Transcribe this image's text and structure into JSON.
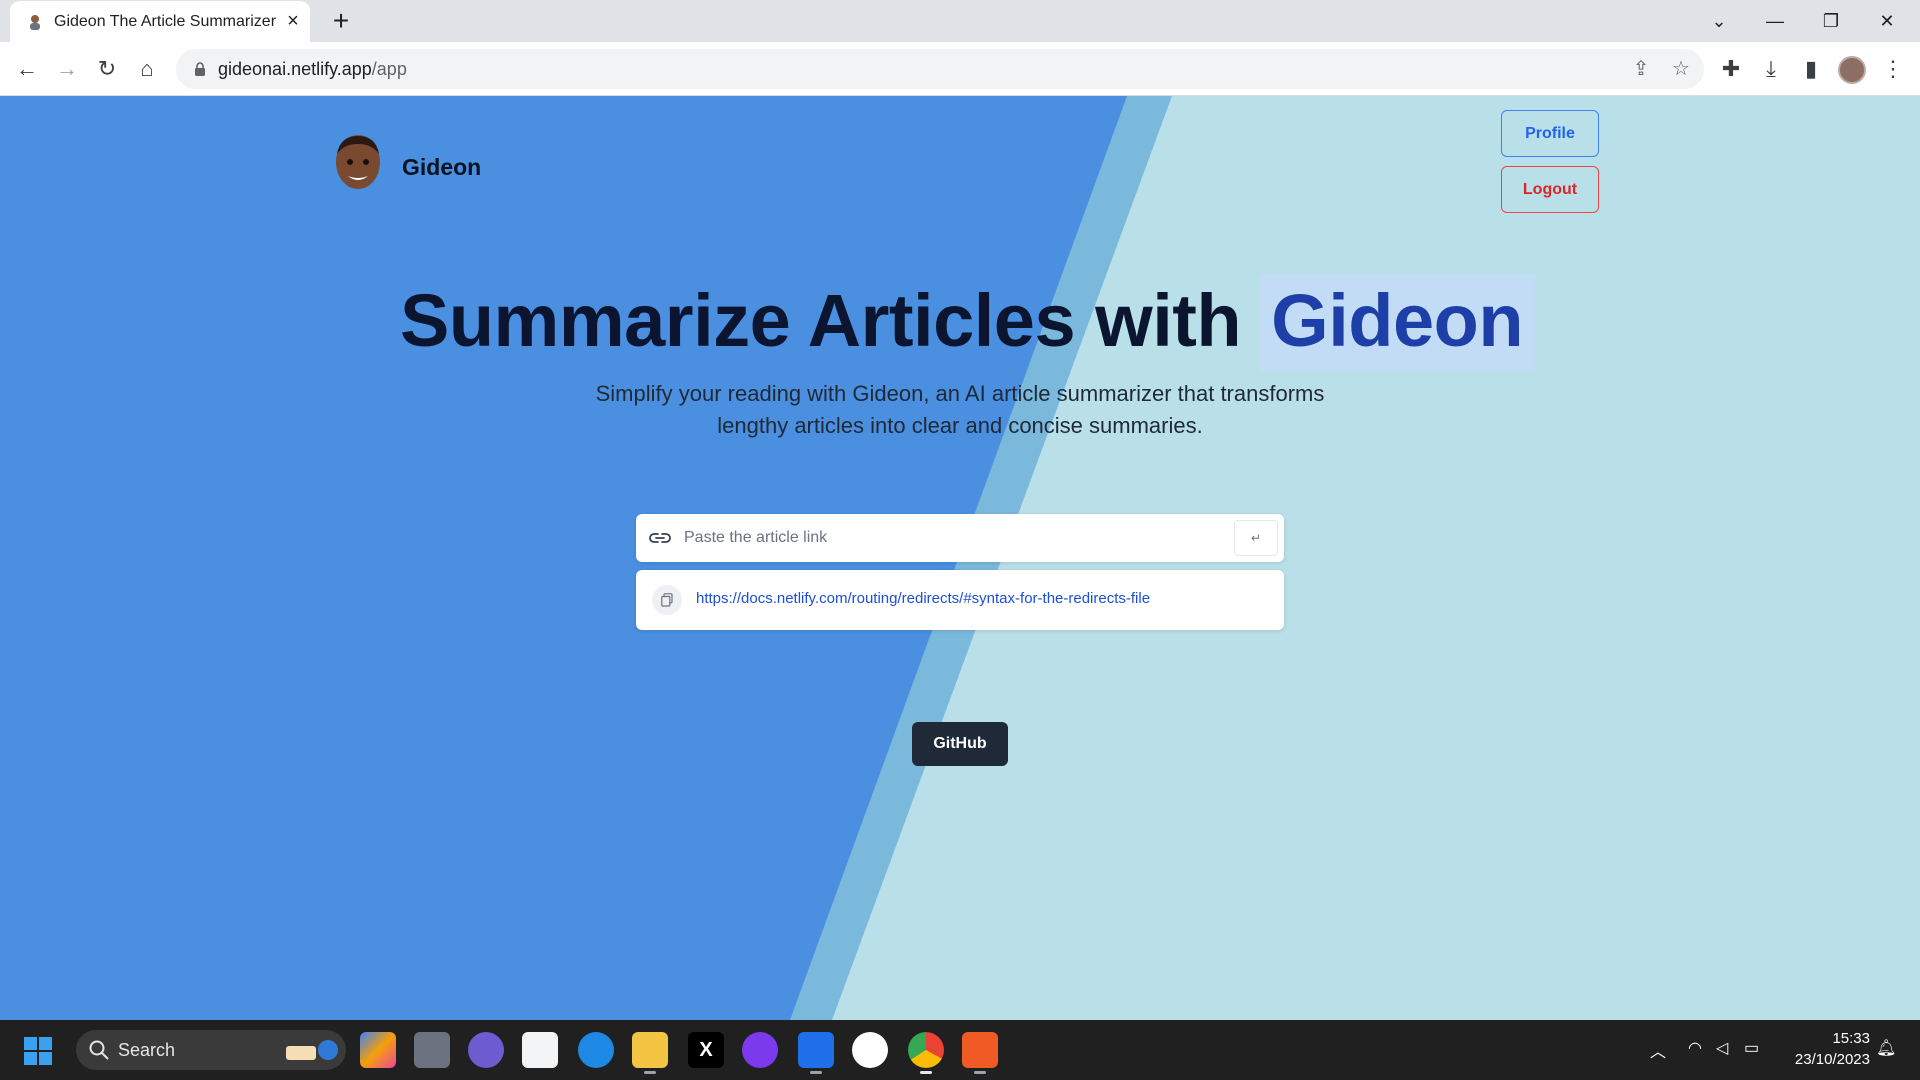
{
  "browser": {
    "tab_title": "Gideon The Article Summarizer",
    "new_tab_label": "+",
    "url_domain": "gideonai.netlify.app",
    "url_path": "/app"
  },
  "header": {
    "brand_name": "Gideon",
    "profile_label": "Profile",
    "logout_label": "Logout"
  },
  "hero": {
    "title": "Summarize Articles with",
    "title_highlight": "Gideon",
    "subtitle_line1": "Simplify your reading with Gideon, an AI article summarizer that transforms",
    "subtitle_line2": "lengthy articles into clear and concise summaries."
  },
  "search": {
    "placeholder": "Paste the article link",
    "submit_label": "↵"
  },
  "history": [
    {
      "url": "https://docs.netlify.com/routing/redirects/#syntax-for-the-redirects-file"
    }
  ],
  "github_label": "GitHub",
  "taskbar": {
    "search_label": "Search",
    "time": "15:33",
    "date": "23/10/2023",
    "apps": [
      "copilot-icon",
      "task-view-icon",
      "teams-icon",
      "store-icon",
      "edge-icon",
      "file-explorer-icon",
      "x-icon",
      "github-desktop-icon",
      "vscode-icon",
      "slack-icon",
      "chrome-icon",
      "brave-icon"
    ]
  },
  "colors": {
    "bg_blue": "#4a8fe0",
    "bg_stripe": "#7ab8dc",
    "bg_light": "#b9dfe9",
    "highlight_bg": "#c3dcf6",
    "highlight_text": "#1e3fa8"
  }
}
